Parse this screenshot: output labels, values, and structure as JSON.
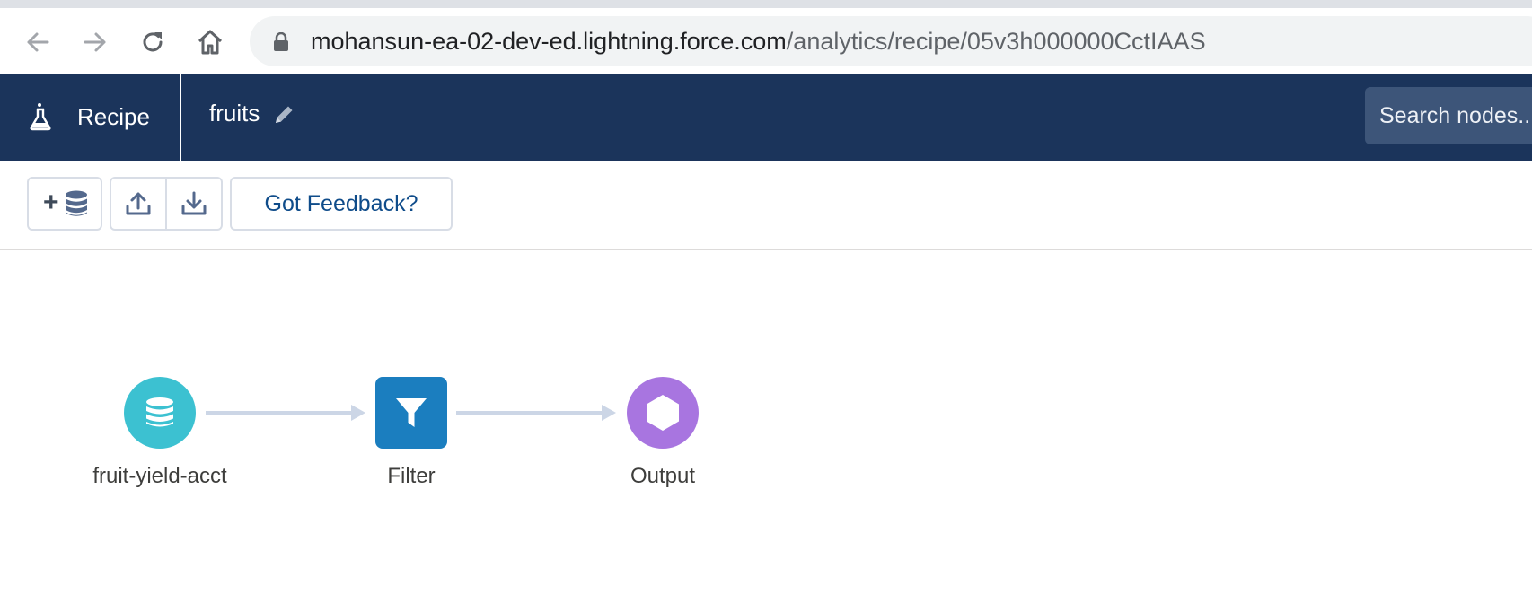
{
  "browser": {
    "url_host": "mohansun-ea-02-dev-ed.lightning.force.com",
    "url_path": "/analytics/recipe/05v3h000000CctIAAS"
  },
  "header": {
    "app_label": "Recipe",
    "recipe_name": "fruits",
    "search_placeholder": "Search nodes..."
  },
  "toolbar": {
    "feedback_label": "Got Feedback?"
  },
  "nodes": [
    {
      "label": "fruit-yield-acct",
      "type": "dataset",
      "color": "#3cc1d1"
    },
    {
      "label": "Filter",
      "type": "filter",
      "color": "#1b7ebf"
    },
    {
      "label": "Output",
      "type": "output",
      "color": "#a875e0"
    }
  ]
}
